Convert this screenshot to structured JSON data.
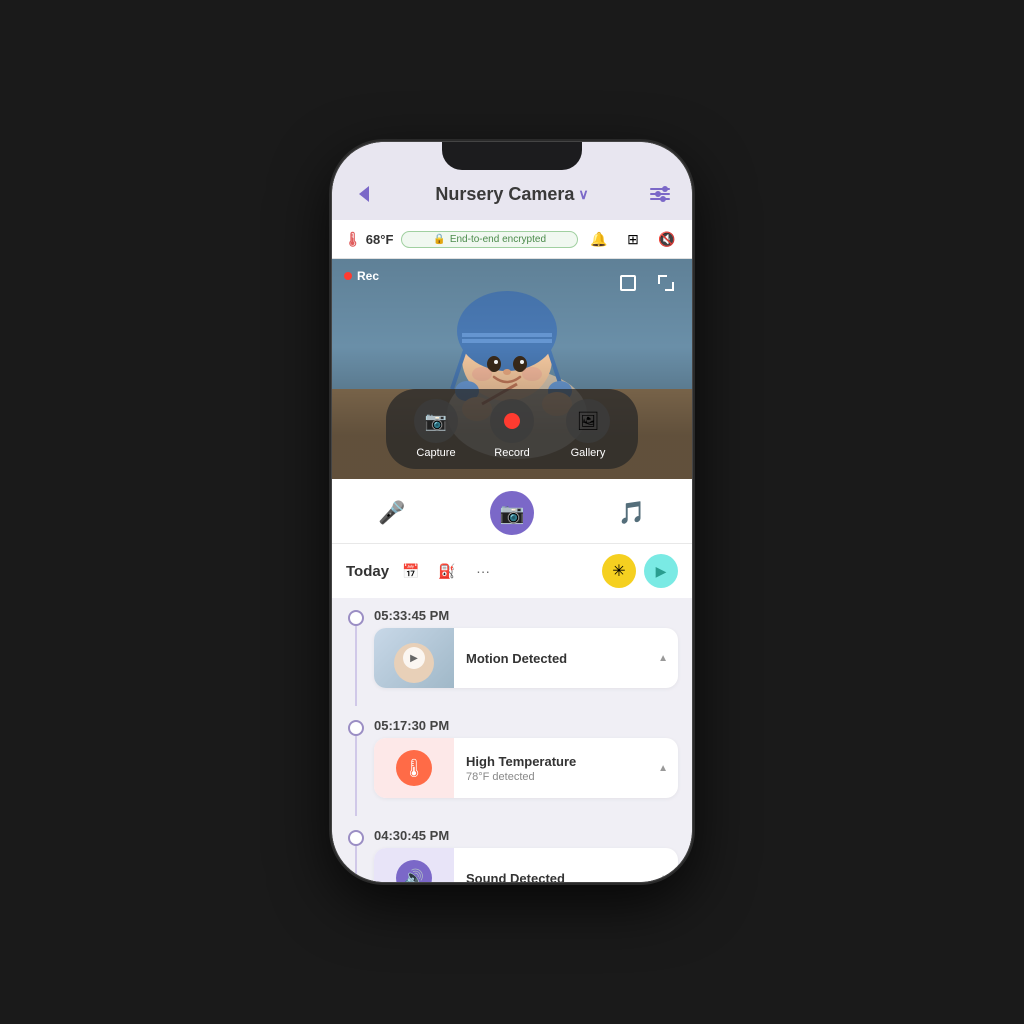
{
  "app": {
    "title": "Nursery Camera",
    "back_label": "Back",
    "settings_label": "Settings"
  },
  "status_bar": {
    "temperature": "68°F",
    "encryption_text": "End-to-end encrypted",
    "bell_icon": "bell",
    "grid_icon": "grid",
    "mute_icon": "mute"
  },
  "video": {
    "rec_label": "Rec",
    "actions": [
      {
        "id": "capture",
        "label": "Capture",
        "icon": "camera"
      },
      {
        "id": "record",
        "label": "Record",
        "icon": "record"
      },
      {
        "id": "gallery",
        "label": "Gallery",
        "icon": "gallery"
      }
    ]
  },
  "controls": {
    "mic_label": "Microphone",
    "camera_label": "Camera",
    "music_label": "Music"
  },
  "timeline": {
    "date_label": "Today",
    "filter_label": "Filter",
    "calendar_label": "Calendar",
    "more_label": "More",
    "sun_label": "Sun mode",
    "play_label": "Play all"
  },
  "events": [
    {
      "time": "05:33:45 PM",
      "type": "motion",
      "title": "Motion Detected",
      "subtitle": "",
      "thumbnail_type": "video"
    },
    {
      "time": "05:17:30 PM",
      "type": "temperature",
      "title": "High Temperature",
      "subtitle": "78°F  detected",
      "thumbnail_type": "temp"
    },
    {
      "time": "04:30:45 PM",
      "type": "sound",
      "title": "Sound Detected",
      "subtitle": "",
      "thumbnail_type": "sound"
    }
  ]
}
